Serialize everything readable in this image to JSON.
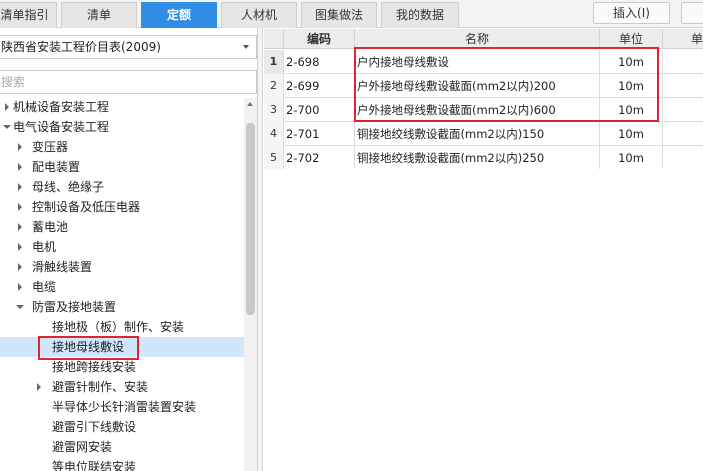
{
  "tabs": [
    {
      "label": "清单指引",
      "active": false
    },
    {
      "label": "清单",
      "active": false
    },
    {
      "label": "定额",
      "active": true
    },
    {
      "label": "人材机",
      "active": false
    },
    {
      "label": "图集做法",
      "active": false
    },
    {
      "label": "我的数据",
      "active": false
    }
  ],
  "toolbar": {
    "insert_label": "插入(I)"
  },
  "left": {
    "library_value": "陕西省安装工程价目表(2009)",
    "search_placeholder": "搜索",
    "tree": [
      {
        "label": "机械设备安装工程",
        "expander": "collapsed"
      },
      {
        "label": "电气设备安装工程",
        "expander": "expanded"
      },
      {
        "label": "变压器",
        "expander": "collapsed"
      },
      {
        "label": "配电装置",
        "expander": "collapsed"
      },
      {
        "label": "母线、绝缘子",
        "expander": "collapsed"
      },
      {
        "label": "控制设备及低压电器",
        "expander": "collapsed"
      },
      {
        "label": "蓄电池",
        "expander": "collapsed"
      },
      {
        "label": "电机",
        "expander": "collapsed"
      },
      {
        "label": "滑触线装置",
        "expander": "collapsed"
      },
      {
        "label": "电缆",
        "expander": "collapsed"
      },
      {
        "label": "防雷及接地装置",
        "expander": "expanded"
      },
      {
        "label": "接地极（板）制作、安装",
        "expander": "none"
      },
      {
        "label": "接地母线敷设",
        "expander": "none",
        "selected": true
      },
      {
        "label": "接地跨接线安装",
        "expander": "none"
      },
      {
        "label": "避雷针制作、安装",
        "expander": "collapsed"
      },
      {
        "label": "半导体少长针消雷装置安装",
        "expander": "none"
      },
      {
        "label": "避雷引下线敷设",
        "expander": "none"
      },
      {
        "label": "避雷网安装",
        "expander": "none"
      },
      {
        "label": "等电位联结安装",
        "expander": "none"
      }
    ]
  },
  "grid": {
    "headers": {
      "code": "编码",
      "name": "名称",
      "unit": "单位",
      "price": "单"
    },
    "rows": [
      {
        "num": "1",
        "code": "2-698",
        "name": "户内接地母线敷设",
        "unit": "10m"
      },
      {
        "num": "2",
        "code": "2-699",
        "name": "户外接地母线敷设截面(mm2以内)200",
        "unit": "10m"
      },
      {
        "num": "3",
        "code": "2-700",
        "name": "户外接地母线敷设截面(mm2以内)600",
        "unit": "10m"
      },
      {
        "num": "4",
        "code": "2-701",
        "name": "铜接地绞线敷设截面(mm2以内)150",
        "unit": "10m"
      },
      {
        "num": "5",
        "code": "2-702",
        "name": "铜接地绞线敷设截面(mm2以内)250",
        "unit": "10m"
      }
    ]
  },
  "colors": {
    "accent": "#2f8de4",
    "highlight": "#e0232e",
    "selected_bg": "#cfe6fb"
  }
}
